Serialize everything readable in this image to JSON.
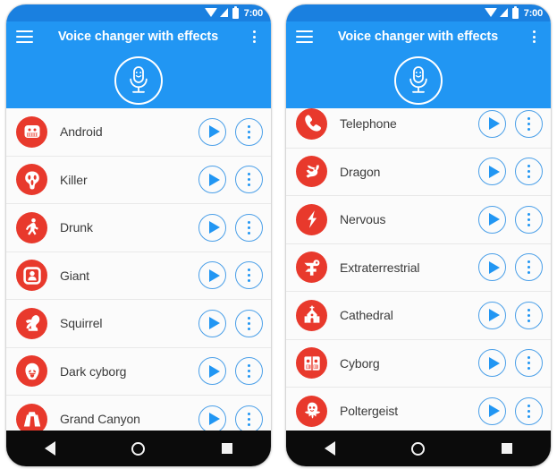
{
  "colors": {
    "appbar_blue": "#2196f3",
    "statusbar_blue": "#1a80e0",
    "avatar_red": "#e8392c",
    "button_outline_blue": "#4a9fe8",
    "list_bg": "#fbfbfb",
    "navbar_black": "#0b0b0b"
  },
  "statusbar": {
    "time": "7:00",
    "icons": [
      "wifi-icon",
      "signal-icon",
      "battery-icon"
    ]
  },
  "appbar": {
    "menu_icon": "hamburger-menu-icon",
    "title": "Voice changer with effects",
    "overflow_icon": "overflow-menu-icon"
  },
  "hero": {
    "mic_button_icon": "microphone-smiley-icon"
  },
  "row_controls": {
    "play_icon": "play-icon",
    "more_icon": "more-options-icon"
  },
  "navbar": {
    "back_icon": "nav-back-icon",
    "home_icon": "nav-home-icon",
    "recents_icon": "nav-recents-icon"
  },
  "phones": [
    {
      "name": "left-phone",
      "first_row_partial": false,
      "effects": [
        {
          "label": "Android",
          "icon": "android-robot-icon"
        },
        {
          "label": "Killer",
          "icon": "ghost-face-mask-icon"
        },
        {
          "label": "Drunk",
          "icon": "dancing-person-icon"
        },
        {
          "label": "Giant",
          "icon": "giant-head-icon"
        },
        {
          "label": "Squirrel",
          "icon": "squirrel-icon"
        },
        {
          "label": "Dark cyborg",
          "icon": "dark-helmet-icon"
        },
        {
          "label": "Grand Canyon",
          "icon": "canyon-mesa-icon"
        }
      ]
    },
    {
      "name": "right-phone",
      "first_row_partial": true,
      "effects": [
        {
          "label": "Telephone",
          "icon": "telephone-handset-icon"
        },
        {
          "label": "Dragon",
          "icon": "dragon-head-icon"
        },
        {
          "label": "Nervous",
          "icon": "lightning-bolt-icon"
        },
        {
          "label": "Extraterrestrial",
          "icon": "alien-head-icon"
        },
        {
          "label": "Cathedral",
          "icon": "cathedral-church-icon"
        },
        {
          "label": "Cyborg",
          "icon": "cyborg-face-icon"
        },
        {
          "label": "Poltergeist",
          "icon": "ghost-icon"
        }
      ]
    }
  ]
}
